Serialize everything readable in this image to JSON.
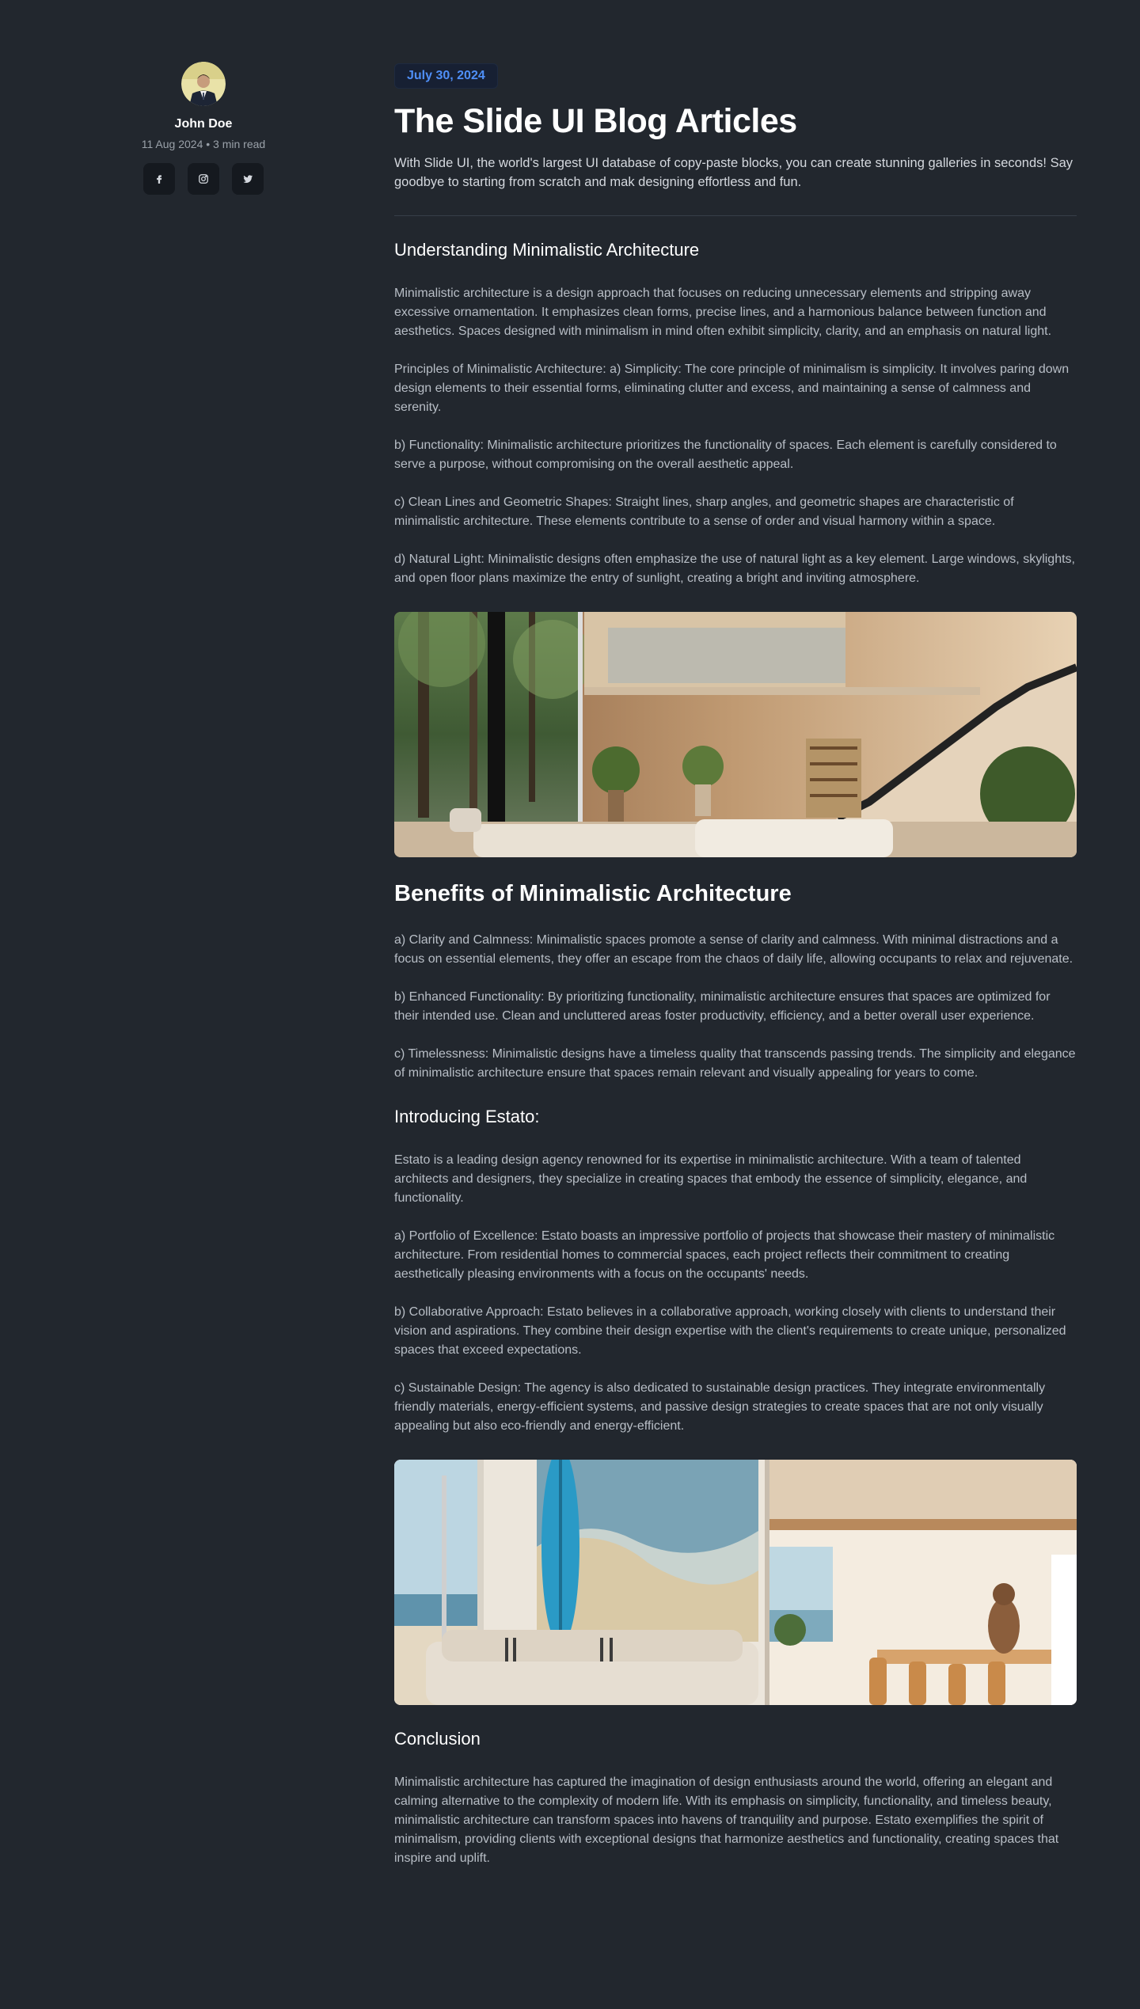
{
  "author": {
    "name": "John Doe",
    "meta": "11 Aug 2024 • 3 min read",
    "socials": [
      {
        "icon": "facebook-icon"
      },
      {
        "icon": "instagram-icon"
      },
      {
        "icon": "twitter-icon"
      }
    ]
  },
  "article": {
    "date": "July 30, 2024",
    "title": "The Slide UI Blog Articles",
    "lead": "With Slide UI, the world's largest UI database of copy-paste blocks, you can create stunning galleries in seconds! Say goodbye to starting from scratch and mak designing effortless and fun.",
    "section1": {
      "heading": "Understanding Minimalistic Architecture",
      "paragraphs": [
        "Minimalistic architecture is a design approach that focuses on reducing unnecessary elements and stripping away excessive ornamentation. It emphasizes clean forms, precise lines, and a harmonious balance between function and aesthetics. Spaces designed with minimalism in mind often exhibit simplicity, clarity, and an emphasis on natural light.",
        "Principles of Minimalistic Architecture: a) Simplicity: The core principle of minimalism is simplicity. It involves paring down design elements to their essential forms, eliminating clutter and excess, and maintaining a sense of calmness and serenity.",
        "b) Functionality: Minimalistic architecture prioritizes the functionality of spaces. Each element is carefully considered to serve a purpose, without compromising on the overall aesthetic appeal.",
        "c) Clean Lines and Geometric Shapes: Straight lines, sharp angles, and geometric shapes are characteristic of minimalistic architecture. These elements contribute to a sense of order and visual harmony within a space.",
        "d) Natural Light: Minimalistic designs often emphasize the use of natural light as a key element. Large windows, skylights, and open floor plans maximize the entry of sunlight, creating a bright and inviting atmosphere."
      ]
    },
    "section2": {
      "heading": "Benefits of Minimalistic Architecture",
      "paragraphs": [
        "a) Clarity and Calmness: Minimalistic spaces promote a sense of clarity and calmness. With minimal distractions and a focus on essential elements, they offer an escape from the chaos of daily life, allowing occupants to relax and rejuvenate.",
        "b) Enhanced Functionality: By prioritizing functionality, minimalistic architecture ensures that spaces are optimized for their intended use. Clean and uncluttered areas foster productivity, efficiency, and a better overall user experience.",
        "c) Timelessness: Minimalistic designs have a timeless quality that transcends passing trends. The simplicity and elegance of minimalistic architecture ensure that spaces remain relevant and visually appealing for years to come."
      ]
    },
    "section3": {
      "heading": "Introducing Estato:",
      "paragraphs": [
        "Estato is a leading design agency renowned for its expertise in minimalistic architecture. With a team of talented architects and designers, they specialize in creating spaces that embody the essence of simplicity, elegance, and functionality.",
        "a) Portfolio of Excellence: Estato boasts an impressive portfolio of projects that showcase their mastery of minimalistic architecture. From residential homes to commercial spaces, each project reflects their commitment to creating aesthetically pleasing environments with a focus on the occupants' needs.",
        "b) Collaborative Approach: Estato believes in a collaborative approach, working closely with clients to understand their vision and aspirations. They combine their design expertise with the client's requirements to create unique, personalized spaces that exceed expectations.",
        "c) Sustainable Design: The agency is also dedicated to sustainable design practices. They integrate environmentally friendly materials, energy-efficient systems, and passive design strategies to create spaces that are not only visually appealing but also eco-friendly and energy-efficient."
      ]
    },
    "section4": {
      "heading": "Conclusion",
      "paragraphs": [
        "Minimalistic architecture has captured the imagination of design enthusiasts around the world, offering an elegant and calming alternative to the complexity of modern life. With its emphasis on simplicity, functionality, and timeless beauty, minimalistic architecture can transform spaces into havens of tranquility and purpose. Estato exemplifies the spirit of minimalism, providing clients with exceptional designs that harmonize aesthetics and functionality, creating spaces that inspire and uplift."
      ]
    }
  },
  "colors": {
    "background": "#22272e",
    "badge_bg": "#172033",
    "badge_text": "#4f8ff7",
    "social_bg": "#15191f"
  }
}
